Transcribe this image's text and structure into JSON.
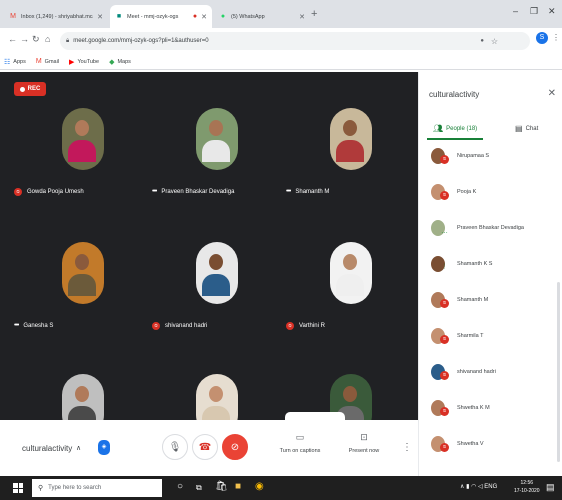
{
  "browser": {
    "tabs": [
      {
        "label": "Inbox (1,249) - shriyabhat.mca19",
        "favicon": "gmail-icon",
        "active": false
      },
      {
        "label": "Meet - mmj-ozyk-ogs",
        "favicon": "meet-icon",
        "active": true
      },
      {
        "label": "(5) WhatsApp",
        "favicon": "whatsapp-icon",
        "active": false
      }
    ],
    "url": "meet.google.com/mmj-ozyk-ogs?pli=1&authuser=0",
    "bookmarks": [
      {
        "label": "Apps",
        "icon": "apps-grid-icon"
      },
      {
        "label": "Gmail",
        "icon": "gmail-icon"
      },
      {
        "label": "YouTube",
        "icon": "youtube-icon"
      },
      {
        "label": "Maps",
        "icon": "maps-icon"
      }
    ],
    "profile_initial": "S"
  },
  "meet": {
    "recording_label": "REC",
    "participants_tiles": [
      {
        "name": "Gowda Pooja Umesh",
        "muted": true,
        "skin": "#b07a5a",
        "shirt": "#c2185b",
        "bg": "#6d6d4a"
      },
      {
        "name": "Praveen Bhaskar Devadiga",
        "muted": false,
        "skin": "#a87454",
        "shirt": "#e8e8e8",
        "bg": "#7f9a6e"
      },
      {
        "name": "Shamanth M",
        "muted": false,
        "skin": "#8a5a3c",
        "shirt": "#b03a3a",
        "bg": "#c8b89a"
      },
      {
        "name": "Ganesha S",
        "muted": false,
        "skin": "#8a5a3c",
        "shirt": "#6b5a3a",
        "bg": "#c27a2a"
      },
      {
        "name": "shivanand hadri",
        "muted": true,
        "skin": "#7a4e32",
        "shirt": "#2b5d8a",
        "bg": "#e8e8e8"
      },
      {
        "name": "Varthini R",
        "muted": true,
        "skin": "#b88a6a",
        "shirt": "#efefef",
        "bg": "#f2f2f2"
      },
      {
        "name": "",
        "muted": false,
        "skin": "#b07a5a",
        "shirt": "#4a4a4a",
        "bg": "#bfbfbf"
      },
      {
        "name": "",
        "muted": false,
        "skin": "#c49070",
        "shirt": "#d8c8b0",
        "bg": "#e6ddd0"
      },
      {
        "name": "",
        "muted": false,
        "skin": "#8a5a3c",
        "shirt": "#6a6a6a",
        "bg": "#3a5a3a"
      }
    ],
    "controls": {
      "meeting_name": "culturalactivity",
      "captions_label": "Turn on captions",
      "present_label": "Present now"
    }
  },
  "panel": {
    "title": "culturalactivity",
    "people_tab": "People (18)",
    "chat_tab": "Chat",
    "people": [
      {
        "name": "Nirupamaa S",
        "muted": true,
        "skin": "#8a5a3c"
      },
      {
        "name": "Pooja K",
        "muted": true,
        "skin": "#c49070"
      },
      {
        "name": "Praveen Bhaskar Devadiga",
        "muted": false,
        "skin": "#a0b088"
      },
      {
        "name": "Shamanth K S",
        "muted": false,
        "talking": true,
        "skin": "#7a4e32"
      },
      {
        "name": "Shamanth M",
        "muted": true,
        "skin": "#b07a5a"
      },
      {
        "name": "Sharmila T",
        "muted": true,
        "skin": "#c49070"
      },
      {
        "name": "shivanand hadri",
        "muted": true,
        "skin": "#2b5d8a"
      },
      {
        "name": "Shwetha K M",
        "muted": true,
        "skin": "#b07a5a"
      },
      {
        "name": "Shwetha V",
        "muted": true,
        "skin": "#c49070"
      }
    ]
  },
  "taskbar": {
    "search_placeholder": "Type here to search",
    "tray_text": "ENG",
    "time": "12:56",
    "date": "17-10-2020"
  },
  "colors": {
    "stage_bg": "#202124",
    "accent_green": "#188038",
    "danger_red": "#d93025",
    "brand_blue": "#1a73e8"
  }
}
